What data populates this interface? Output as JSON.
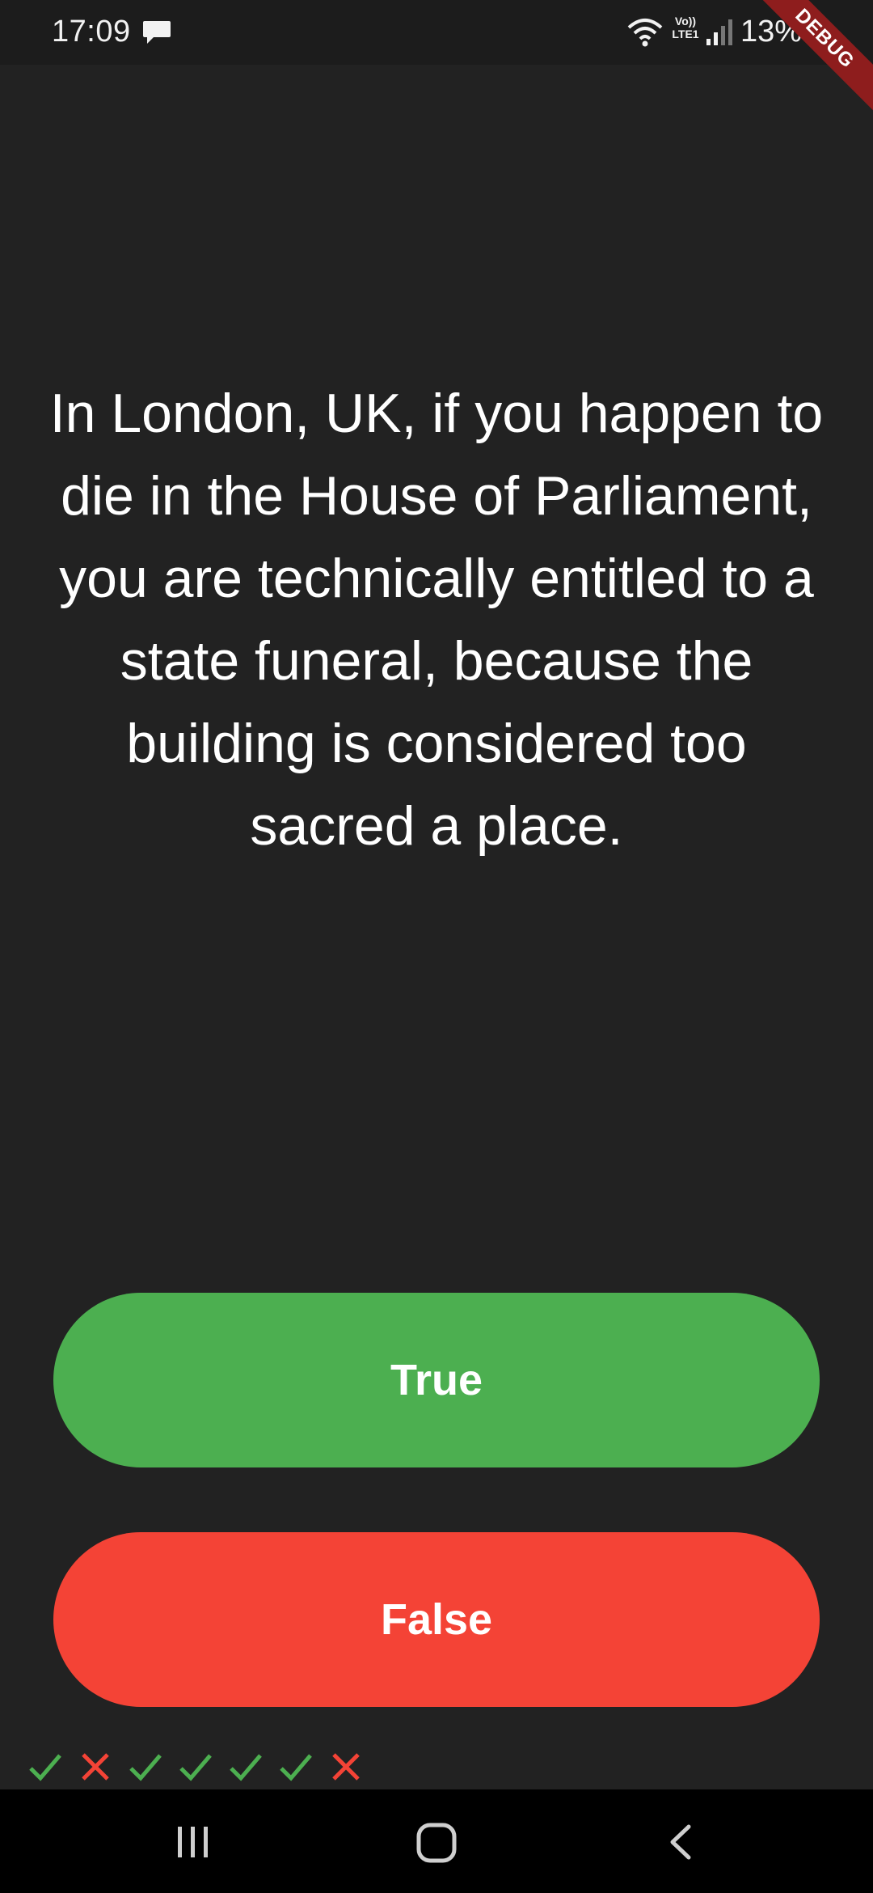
{
  "status_bar": {
    "time": "17:09",
    "battery": "13%",
    "network": "Vo)) LTE1",
    "icons": [
      "message-icon",
      "wifi-icon",
      "lte-icon",
      "signal-icon"
    ]
  },
  "debug_banner": "DEBUG",
  "question": {
    "text": "In London, UK, if you happen to die in the House of Parliament, you are technically entitled to a state funeral, because the building is considered too sacred a place."
  },
  "buttons": {
    "true_label": "True",
    "false_label": "False"
  },
  "score_keeper": [
    "correct",
    "wrong",
    "correct",
    "correct",
    "correct",
    "correct",
    "wrong"
  ],
  "colors": {
    "background": "#222222",
    "true_button": "#4caf50",
    "false_button": "#f44336",
    "check": "#4caf50",
    "cross": "#f44336"
  },
  "nav_bar": {
    "icons": [
      "recents-icon",
      "home-icon",
      "back-icon"
    ]
  }
}
